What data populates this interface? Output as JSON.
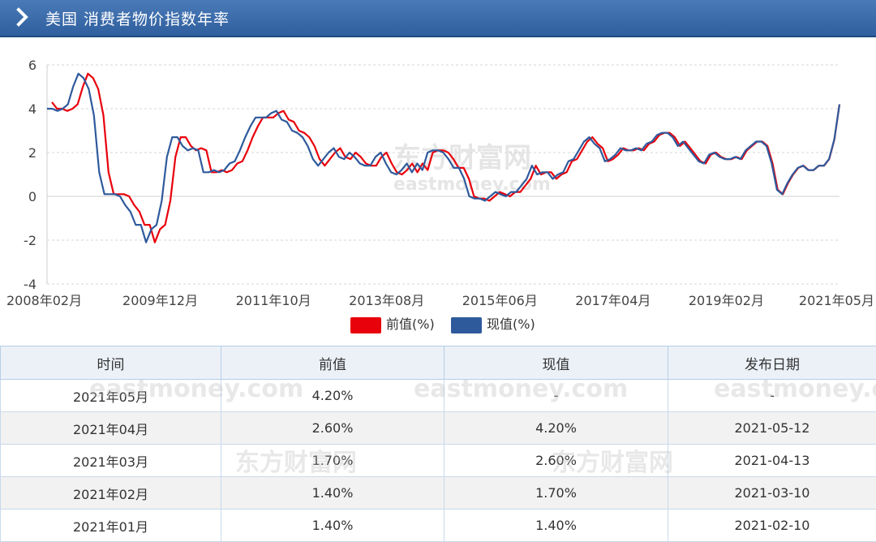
{
  "header": {
    "title": "美国  消费者物价指数年率"
  },
  "chart_data": {
    "type": "line",
    "ylim": [
      -4,
      6
    ],
    "yticks": [
      "6",
      "4",
      "2",
      "0",
      "-2",
      "-4"
    ],
    "xticks": [
      "2008年02月",
      "2009年12月",
      "2011年10月",
      "2013年08月",
      "2015年06月",
      "2017年04月",
      "2019年02月",
      "2021年05月"
    ],
    "watermark": [
      "东方财富网",
      "eastmoney.com"
    ],
    "legend_position": "bottom",
    "colors": {
      "prev": "#e8000b",
      "curr": "#2e5a9c"
    },
    "series": [
      {
        "name": "前值(%)",
        "values": [
          4.3,
          4.0,
          4.0,
          3.9,
          4.0,
          4.2,
          5.0,
          5.6,
          5.4,
          4.9,
          3.7,
          1.1,
          0.1,
          0.1,
          0.1,
          0.0,
          -0.4,
          -0.7,
          -1.3,
          -1.3,
          -2.1,
          -1.5,
          -1.3,
          -0.2,
          1.8,
          2.7,
          2.7,
          2.3,
          2.1,
          2.2,
          2.1,
          1.1,
          1.1,
          1.2,
          1.1,
          1.2,
          1.5,
          1.6,
          2.1,
          2.7,
          3.2,
          3.6,
          3.6,
          3.6,
          3.8,
          3.9,
          3.5,
          3.4,
          3.0,
          2.9,
          2.7,
          2.3,
          1.7,
          1.4,
          1.7,
          2.0,
          2.2,
          1.8,
          1.7,
          2.0,
          1.8,
          1.5,
          1.4,
          1.4,
          1.8,
          2.0,
          1.5,
          1.1,
          1.0,
          1.2,
          1.5,
          1.1,
          1.5,
          1.2,
          2.0,
          2.1,
          2.1,
          2.0,
          1.7,
          1.3,
          1.3,
          0.8,
          0.0,
          -0.1,
          -0.1,
          -0.2,
          0.0,
          0.2,
          0.1,
          0.0,
          0.2,
          0.2,
          0.5,
          0.8,
          1.4,
          1.0,
          1.1,
          1.1,
          0.8,
          1.0,
          1.1,
          1.6,
          1.7,
          2.1,
          2.5,
          2.7,
          2.4,
          2.2,
          1.6,
          1.7,
          1.9,
          2.2,
          2.1,
          2.1,
          2.2,
          2.1,
          2.4,
          2.5,
          2.8,
          2.9,
          2.9,
          2.7,
          2.3,
          2.5,
          2.2,
          1.9,
          1.6,
          1.5,
          1.9,
          2.0,
          1.8,
          1.7,
          1.7,
          1.8,
          1.7,
          2.1,
          2.3,
          2.5,
          2.5,
          2.3,
          1.5,
          0.3,
          0.1,
          0.6,
          1.0,
          1.3,
          1.4,
          1.2,
          1.2,
          1.4,
          1.4,
          1.7,
          2.6,
          4.2
        ]
      },
      {
        "name": "现值(%)",
        "values": [
          4.0,
          4.0,
          3.9,
          4.0,
          4.2,
          5.0,
          5.6,
          5.4,
          4.9,
          3.7,
          1.1,
          0.1,
          0.1,
          0.1,
          0.0,
          -0.4,
          -0.7,
          -1.3,
          -1.3,
          -2.1,
          -1.5,
          -1.3,
          -0.2,
          1.8,
          2.7,
          2.7,
          2.3,
          2.1,
          2.2,
          2.1,
          1.1,
          1.1,
          1.2,
          1.1,
          1.2,
          1.5,
          1.6,
          2.1,
          2.7,
          3.2,
          3.6,
          3.6,
          3.6,
          3.8,
          3.9,
          3.5,
          3.4,
          3.0,
          2.9,
          2.7,
          2.3,
          1.7,
          1.4,
          1.7,
          2.0,
          2.2,
          1.8,
          1.7,
          2.0,
          1.8,
          1.5,
          1.4,
          1.4,
          1.8,
          2.0,
          1.5,
          1.1,
          1.0,
          1.2,
          1.5,
          1.1,
          1.5,
          1.2,
          2.0,
          2.1,
          2.1,
          2.0,
          1.7,
          1.3,
          1.3,
          0.8,
          0.0,
          -0.1,
          -0.1,
          -0.2,
          0.0,
          0.2,
          0.1,
          0.0,
          0.2,
          0.2,
          0.5,
          0.8,
          1.4,
          1.0,
          1.1,
          1.1,
          0.8,
          1.0,
          1.1,
          1.6,
          1.7,
          2.1,
          2.5,
          2.7,
          2.4,
          2.2,
          1.6,
          1.7,
          1.9,
          2.2,
          2.1,
          2.1,
          2.2,
          2.1,
          2.4,
          2.5,
          2.8,
          2.9,
          2.9,
          2.7,
          2.3,
          2.5,
          2.2,
          1.9,
          1.6,
          1.5,
          1.9,
          2.0,
          1.8,
          1.7,
          1.7,
          1.8,
          1.7,
          2.1,
          2.3,
          2.5,
          2.5,
          2.3,
          1.5,
          0.3,
          0.1,
          0.6,
          1.0,
          1.3,
          1.4,
          1.2,
          1.2,
          1.4,
          1.4,
          1.7,
          2.6,
          4.2
        ]
      }
    ]
  },
  "table": {
    "headers": [
      "时间",
      "前值",
      "现值",
      "发布日期"
    ],
    "rows": [
      [
        "2021年05月",
        "4.20%",
        "-",
        "-"
      ],
      [
        "2021年04月",
        "2.60%",
        "4.20%",
        "2021-05-12"
      ],
      [
        "2021年03月",
        "1.70%",
        "2.60%",
        "2021-04-13"
      ],
      [
        "2021年02月",
        "1.40%",
        "1.70%",
        "2021-03-10"
      ],
      [
        "2021年01月",
        "1.40%",
        "1.40%",
        "2021-02-10"
      ]
    ]
  }
}
